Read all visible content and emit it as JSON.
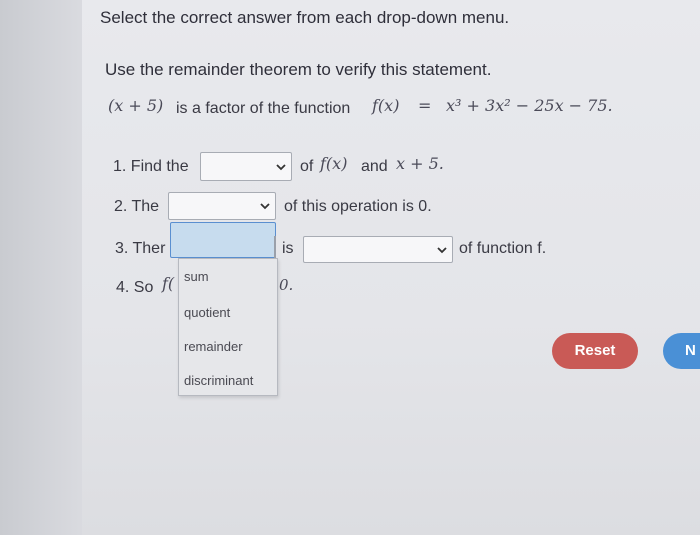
{
  "title": "Select the correct answer from each drop-down menu.",
  "instruction": "Use the remainder theorem to verify this statement.",
  "statement": {
    "factor": "(x + 5)",
    "text": "is a factor of the function",
    "function": "f(x)",
    "equals": "=",
    "expression": "x³ + 3x² − 25x − 75."
  },
  "steps": {
    "step1": {
      "label": "1. Find the",
      "after": "of",
      "f": "f(x)",
      "and": "and",
      "divisor": "x + 5."
    },
    "step2": {
      "label": "2. The",
      "after": "of this operation is 0."
    },
    "step3": {
      "label": "3. Ther",
      "is": "is",
      "after": "of function f."
    },
    "step4": {
      "label": "4. So",
      "f": "f(",
      "tail": "0."
    }
  },
  "dropdown_options": [
    "sum",
    "quotient",
    "remainder",
    "discriminant"
  ],
  "buttons": {
    "reset": "Reset",
    "next": "N"
  },
  "colors": {
    "reset": "#c95a56",
    "next": "#4a90d6",
    "highlight": "#c7dcee"
  }
}
